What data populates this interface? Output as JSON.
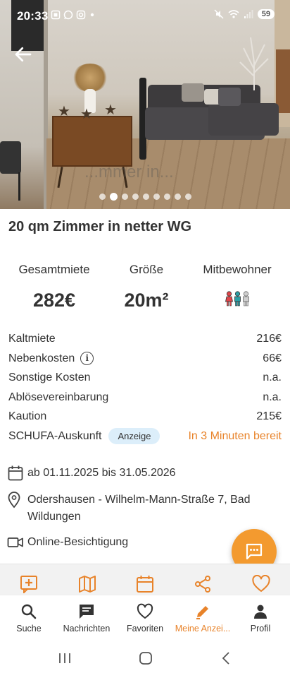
{
  "status_bar": {
    "time": "20:33",
    "battery": "59",
    "left_icons": [
      "screenshot-icon",
      "whatsapp-icon",
      "instagram-icon",
      "dot-icon"
    ],
    "right_icons": [
      "mute-icon",
      "wifi-icon",
      "signal-icon",
      "battery-icon"
    ]
  },
  "gallery": {
    "image_count": 9,
    "active_index": 1,
    "watermark": "...mmer in..."
  },
  "listing": {
    "title": "20 qm Zimmer in netter WG"
  },
  "stats": {
    "rent_label": "Gesamtmiete",
    "rent_value": "282€",
    "size_label": "Größe",
    "size_value": "20m²",
    "flatmates_label": "Mitbewohner",
    "flatmates_icons": [
      "flatmate-female-icon",
      "flatmate-male-icon",
      "flatmate-vacant-icon"
    ]
  },
  "costs": [
    {
      "label": "Kaltmiete",
      "value": "216€"
    },
    {
      "label": "Nebenkosten",
      "value": "66€",
      "info": true
    },
    {
      "label": "Sonstige Kosten",
      "value": "n.a."
    },
    {
      "label": "Ablösevereinbarung",
      "value": "n.a."
    },
    {
      "label": "Kaution",
      "value": "215€"
    },
    {
      "label": "SCHUFA-Auskunft",
      "tag": "Anzeige",
      "value": "In 3 Minuten bereit"
    }
  ],
  "details": {
    "date": "ab 01.11.2025 bis 31.05.2026",
    "address": "Odershausen - Wilhelm-Mann-Straße 7, Bad Wildungen",
    "viewing": "Online-Besichtigung"
  },
  "colors": {
    "accent": "#e8832a",
    "fab": "#f39a2f",
    "tag_bg": "#dceefa",
    "text": "#333333"
  },
  "action_bar": [
    "add-note-icon",
    "map-icon",
    "calendar-icon",
    "share-icon",
    "favorite-icon"
  ],
  "bottom_nav": [
    {
      "label": "Suche",
      "icon": "search-icon"
    },
    {
      "label": "Nachrichten",
      "icon": "messages-icon"
    },
    {
      "label": "Favoriten",
      "icon": "heart-icon"
    },
    {
      "label": "Meine Anzei...",
      "icon": "pencil-icon",
      "active": true
    },
    {
      "label": "Profil",
      "icon": "profile-icon"
    }
  ],
  "system_nav": [
    "recents-button",
    "home-button",
    "back-button"
  ]
}
